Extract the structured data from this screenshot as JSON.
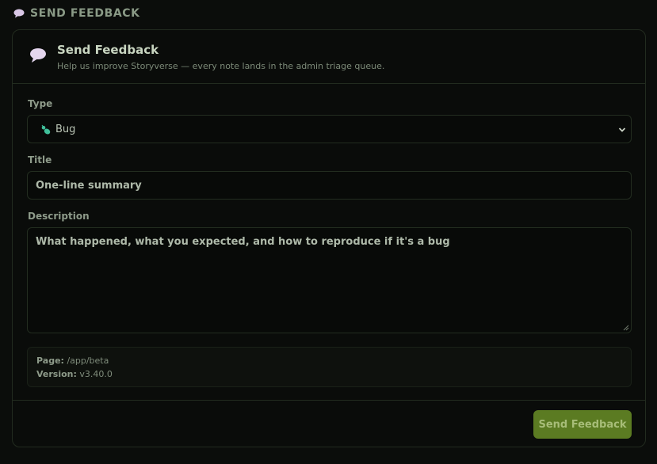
{
  "header": {
    "icon": "speech-bubble-icon",
    "label": "SEND FEEDBACK"
  },
  "card": {
    "icon": "speech-bubble-icon",
    "title": "Send Feedback",
    "subtitle": "Help us improve Storyverse — every note lands in the admin triage queue."
  },
  "form": {
    "type_label": "Type",
    "type_value": "Bug",
    "type_icon": "bug-icon",
    "title_label": "Title",
    "title_placeholder": "One-line summary",
    "description_label": "Description",
    "description_placeholder": "What happened, what you expected, and how to reproduce if it's a bug"
  },
  "meta": {
    "page_label": "Page:",
    "page_value": "/app/beta",
    "version_label": "Version:",
    "version_value": "v3.40.0"
  },
  "actions": {
    "submit_label": "Send Feedback"
  },
  "colors": {
    "accent": "#5b7b22",
    "background": "#0b0d0b"
  }
}
